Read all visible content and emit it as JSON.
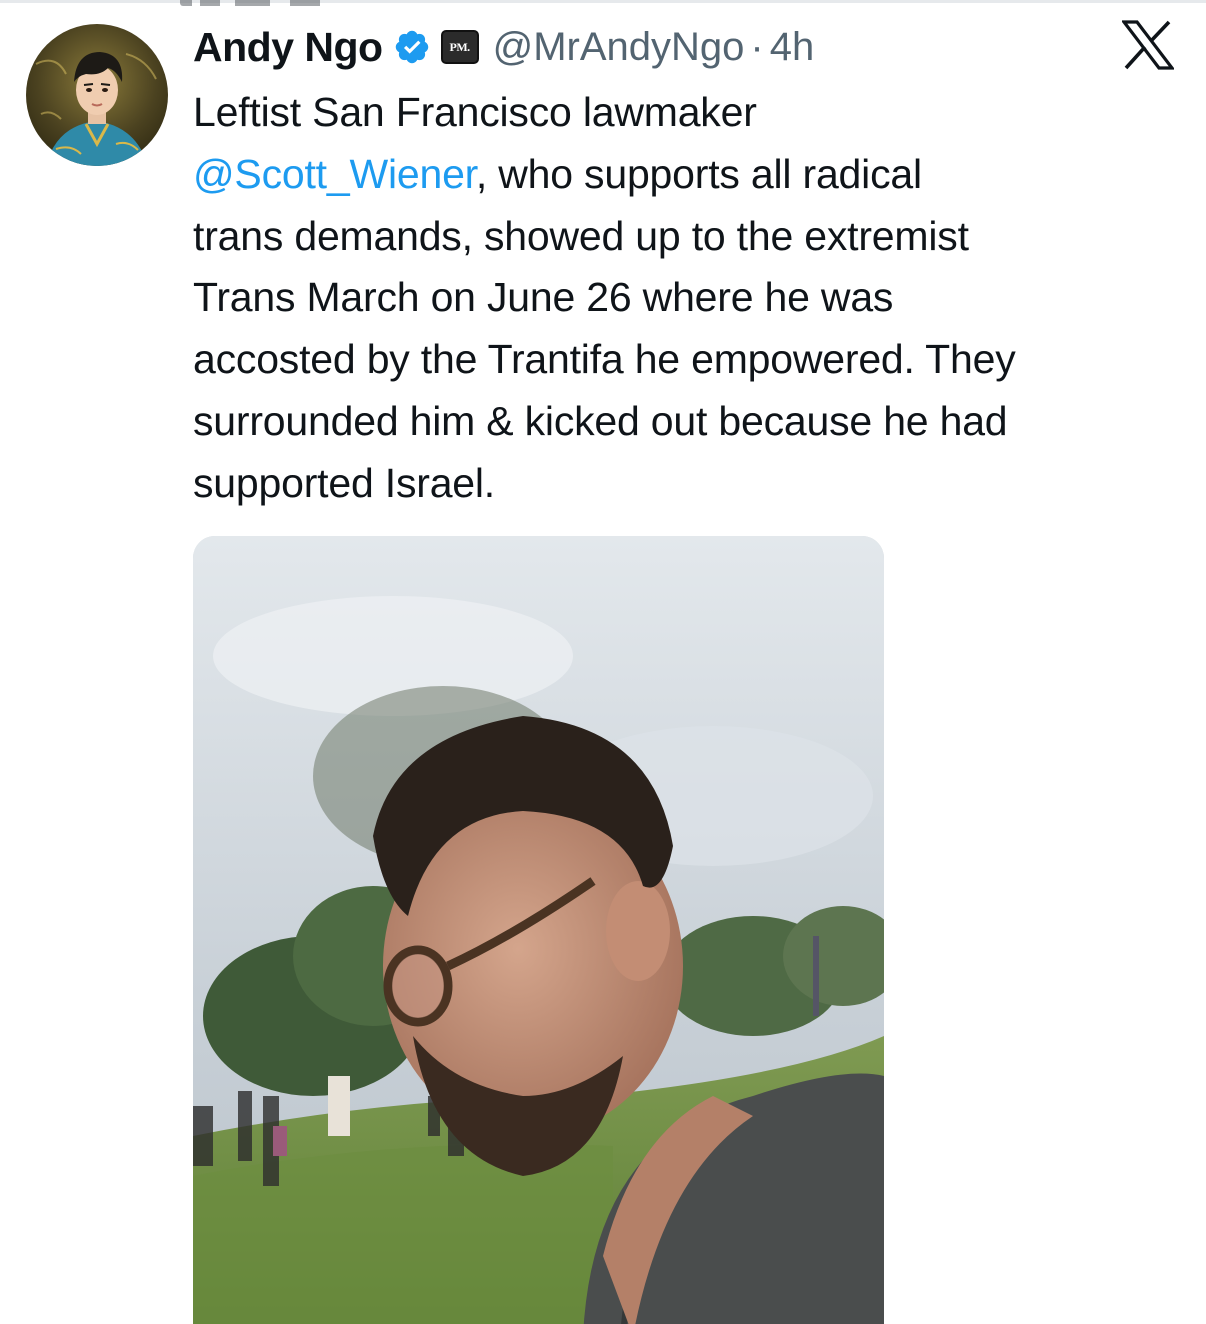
{
  "author": {
    "display_name": "Andy Ngo",
    "handle": "@MrAndyNgo",
    "separator": "·",
    "time": "4h",
    "affiliate_badge": "PM.",
    "verified_color": "#1d9bf0"
  },
  "tweet": {
    "text_lines": [
      {
        "before": "Leftist San Francisco lawmaker",
        "mention": "",
        "after": ""
      },
      {
        "before": "",
        "mention": "@Scott_Wiener",
        "after": ", who supports all radical"
      },
      {
        "before": "trans demands, showed up to the extremist",
        "mention": "",
        "after": ""
      },
      {
        "before": "Trans March on June 26 where he was",
        "mention": "",
        "after": ""
      },
      {
        "before": "accosted by the Trantifa he empowered. They",
        "mention": "",
        "after": ""
      },
      {
        "before": "surrounded him & kicked out because he had",
        "mention": "",
        "after": ""
      },
      {
        "before": "supported Israel.",
        "mention": "",
        "after": ""
      }
    ],
    "mention_color": "#1d9bf0"
  },
  "icons": {
    "verified": "verified-badge-icon",
    "platform": "x-logo-icon",
    "affiliate": "affiliate-badge-icon"
  }
}
